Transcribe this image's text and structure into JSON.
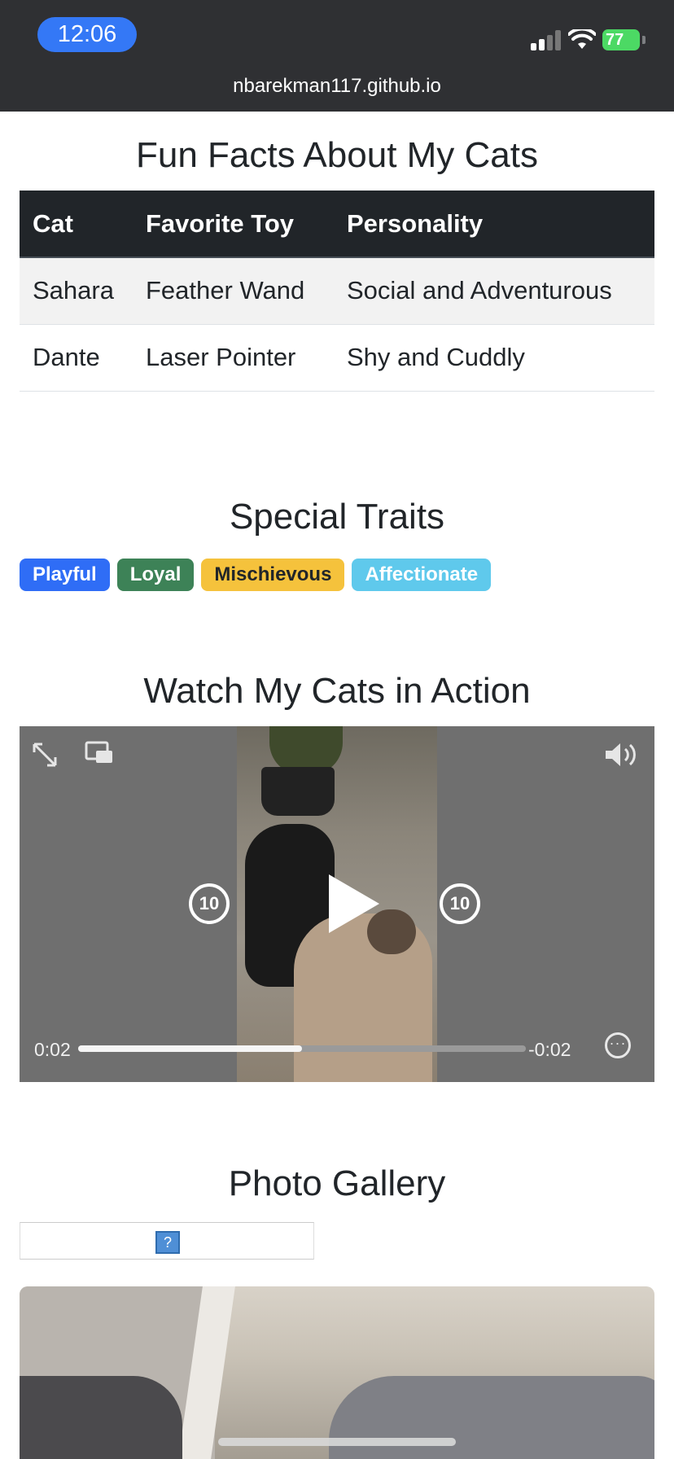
{
  "status_bar": {
    "time": "12:06",
    "battery": "77",
    "url": "nbarekman117.github.io"
  },
  "facts": {
    "title": "Fun Facts About My Cats",
    "columns": [
      "Cat",
      "Favorite Toy",
      "Personality"
    ],
    "rows": [
      [
        "Sahara",
        "Feather Wand",
        "Social and Adventurous"
      ],
      [
        "Dante",
        "Laser Pointer",
        "Shy and Cuddly"
      ]
    ]
  },
  "traits": {
    "title": "Special Traits",
    "badges": [
      {
        "label": "Playful",
        "bg": "#2f6df6",
        "fg": "#ffffff"
      },
      {
        "label": "Loyal",
        "bg": "#3d8257",
        "fg": "#ffffff"
      },
      {
        "label": "Mischievous",
        "bg": "#f5c23c",
        "fg": "#212529"
      },
      {
        "label": "Affectionate",
        "bg": "#5fc9ec",
        "fg": "#ffffff"
      }
    ]
  },
  "video": {
    "title": "Watch My Cats in Action",
    "elapsed": "0:02",
    "remaining": "-0:02",
    "progress": 0.5,
    "skip_back": "10",
    "skip_forward": "10"
  },
  "gallery": {
    "title": "Photo Gallery",
    "broken_image_glyph": "?"
  }
}
